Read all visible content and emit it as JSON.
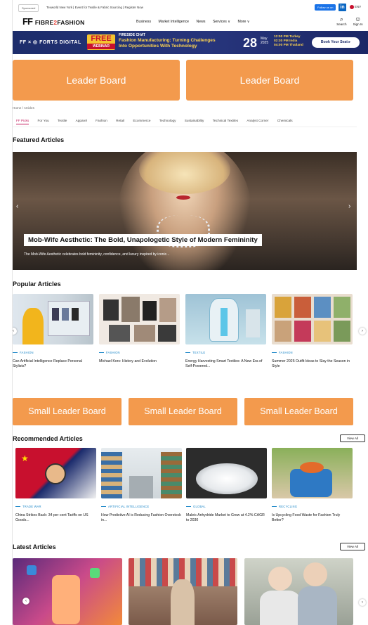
{
  "topbar": {
    "sponsored": "Sponsored",
    "ticker": "Texworld New York | Event for Textile & Fabric Sourcing | Register Now",
    "follow": "Follow us on",
    "linkedin": "in",
    "lang": "ENV"
  },
  "nav": {
    "logo_ff": "FF",
    "logo_name_a": "FIBRE",
    "logo_amp": "2",
    "logo_name_b": "FASHION",
    "links": [
      "Business",
      "Market Intelligence",
      "News",
      "Services ∨",
      "More ∨"
    ],
    "search": "Search",
    "signin": "Sign In"
  },
  "banner": {
    "brand": "FF × ◎ FORTS DIGITAL",
    "free": "FREE",
    "webinar": "WEBINAR",
    "fireside": "FIRESIDE CHAT",
    "headline1": "Fashion Manufacturing: Turning Challenges",
    "headline2": "Into Opportunities With Technology",
    "date": "28",
    "month": "May",
    "year": "2025",
    "time1": "12:00 PM Turkey",
    "time2": "02:30 PM India",
    "time3": "04:00 PM Thailand",
    "book": "Book Your Seat ▸"
  },
  "leaderboards": [
    "Leader Board",
    "Leader Board"
  ],
  "breadcrumb": "Home / Articles",
  "categories": [
    "FF Picks",
    "For You",
    "Textile",
    "Apparel",
    "Fashion",
    "Retail",
    "Ecommerce",
    "Technology",
    "Sustainability",
    "Technical Textiles",
    "Analyst Corner",
    "Chemicals"
  ],
  "featured": {
    "heading": "Featured Articles",
    "title": "Mob-Wife Aesthetic: The Bold, Unapologetic Style of Modern Femininity",
    "desc": "The Mob-Wife Aesthetic celebrates bold femininity, confidence, and luxury inspired by iconic..."
  },
  "popular": {
    "heading": "Popular Articles",
    "items": [
      {
        "tag": "FASHION",
        "title": "Can Artificial Intelligence Replace Personal Stylists?"
      },
      {
        "tag": "FASHION",
        "title": "Michael Kors: History and Evolution"
      },
      {
        "tag": "TEXTILE",
        "title": "Energy Harvesting Smart Textiles: A New Era of Self-Powered..."
      },
      {
        "tag": "FASHION",
        "title": "Summer 2025 Outfit Ideas to Slay the Season in Style"
      }
    ]
  },
  "small_leaderboards": [
    "Small Leader Board",
    "Small Leader Board",
    "Small Leader Board"
  ],
  "recommended": {
    "heading": "Recommended Articles",
    "view_all": "View All",
    "items": [
      {
        "tag": "TRADE WAR",
        "title": "China Strikes Back: 34 per cent Tariffs on US Goods..."
      },
      {
        "tag": "ARTIFICIAL INTELLIGENCE",
        "title": "How Predictive AI is Reducing Fashion Overstock in..."
      },
      {
        "tag": "GLOBAL",
        "title": "Maleic Anhydride Market to Grow at 4.2% CAGR to 2030"
      },
      {
        "tag": "RECYCLING",
        "title": "Is Upcycling Food Waste for Fashion Truly Better?"
      }
    ]
  },
  "latest": {
    "heading": "Latest Articles",
    "view_all": "View All"
  },
  "icons": {
    "prev": "‹",
    "next": "›",
    "search": "⌕",
    "user": "☺"
  },
  "colors": {
    "accent": "#f39a4d",
    "navy": "#1d2d6b",
    "tag": "#1e88c8",
    "active": "#c2185b"
  }
}
